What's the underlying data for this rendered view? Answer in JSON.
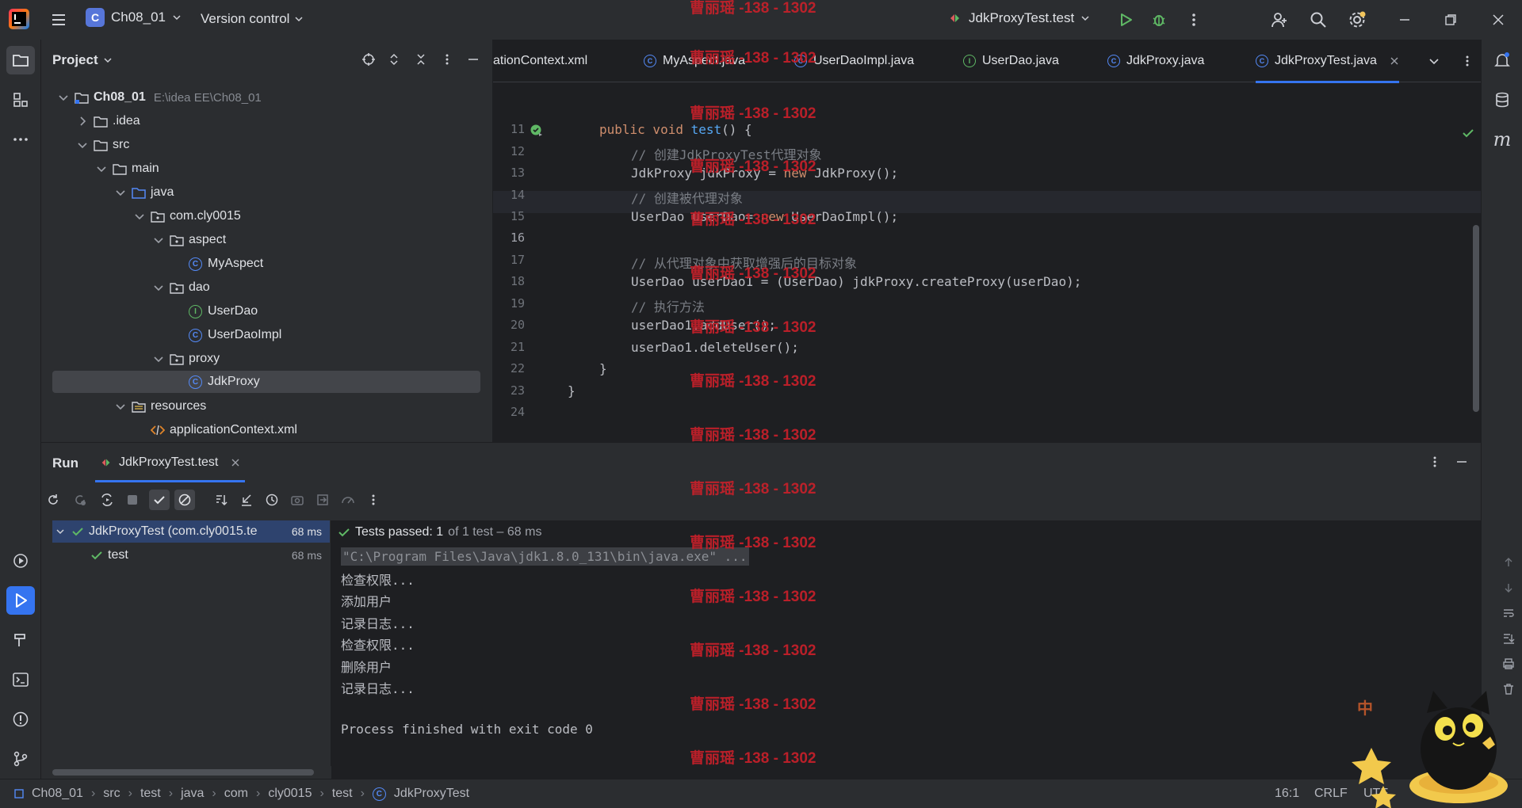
{
  "titlebar": {
    "project_name": "Ch08_01",
    "project_badge": "C",
    "vcs_label": "Version control",
    "run_config": "JdkProxyTest.test"
  },
  "project_panel": {
    "title": "Project",
    "tree": [
      {
        "label": "Ch08_01",
        "hint": "E:\\idea EE\\Ch08_01"
      },
      {
        "label": ".idea"
      },
      {
        "label": "src"
      },
      {
        "label": "main"
      },
      {
        "label": "java"
      },
      {
        "label": "com.cly0015"
      },
      {
        "label": "aspect"
      },
      {
        "label": "MyAspect"
      },
      {
        "label": "dao"
      },
      {
        "label": "UserDao"
      },
      {
        "label": "UserDaoImpl"
      },
      {
        "label": "proxy"
      },
      {
        "label": "JdkProxy"
      },
      {
        "label": "resources"
      },
      {
        "label": "applicationContext.xml"
      }
    ]
  },
  "editor": {
    "tabs": [
      {
        "label": "ationContext.xml"
      },
      {
        "label": "MyAspect.java"
      },
      {
        "label": "UserDaoImpl.java"
      },
      {
        "label": "UserDao.java"
      },
      {
        "label": "JdkProxy.java"
      },
      {
        "label": "JdkProxyTest.java"
      }
    ],
    "line_numbers": [
      "11",
      "12",
      "13",
      "14",
      "15",
      "16",
      "17",
      "18",
      "19",
      "20",
      "21",
      "22",
      "23",
      "24"
    ],
    "code": {
      "l11_a": "public void ",
      "l11_b": "test",
      "l11_c": "() {",
      "l12": "// 创建JdkProxyTest代理对象",
      "l13_a": "JdkProxy jdkProxy = ",
      "l13_b": "new ",
      "l13_c": "JdkProxy();",
      "l14": "// 创建被代理对象",
      "l15_a": "UserDao userDao= ",
      "l15_b": "new ",
      "l15_c": "UserDaoImpl();",
      "l17": "// 从代理对象中获取增强后的目标对象",
      "l18": "UserDao userDao1 = (UserDao) jdkProxy.createProxy(userDao);",
      "l19": "// 执行方法",
      "l20": "userDao1.addUser();",
      "l21": "userDao1.deleteUser();",
      "l22": "}",
      "l23": "}"
    }
  },
  "run_window": {
    "title": "Run",
    "tab_label": "JdkProxyTest.test",
    "test_tree": [
      {
        "label": "JdkProxyTest (com.cly0015.te",
        "time": "68 ms"
      },
      {
        "label": "test",
        "time": "68 ms"
      }
    ],
    "summary": {
      "passed_label": "Tests passed: 1",
      "rest": "of 1 test – 68 ms"
    },
    "console": [
      "\"C:\\Program Files\\Java\\jdk1.8.0_131\\bin\\java.exe\" ...",
      "检查权限...",
      "添加用户",
      "记录日志...",
      "检查权限...",
      "删除用户",
      "记录日志...",
      "",
      "Process finished with exit code 0"
    ]
  },
  "statusbar": {
    "breadcrumb": [
      "Ch08_01",
      "src",
      "test",
      "java",
      "com",
      "cly0015",
      "test",
      "JdkProxyTest"
    ],
    "caret": "16:1",
    "line_sep": "CRLF",
    "encoding": "UTF"
  },
  "watermark": "曹丽瑶 -138 - 1302",
  "mascot_badge": "中",
  "colors": {
    "accent": "#3574f0",
    "pass": "#5fb865",
    "watermark": "#c8202a"
  }
}
